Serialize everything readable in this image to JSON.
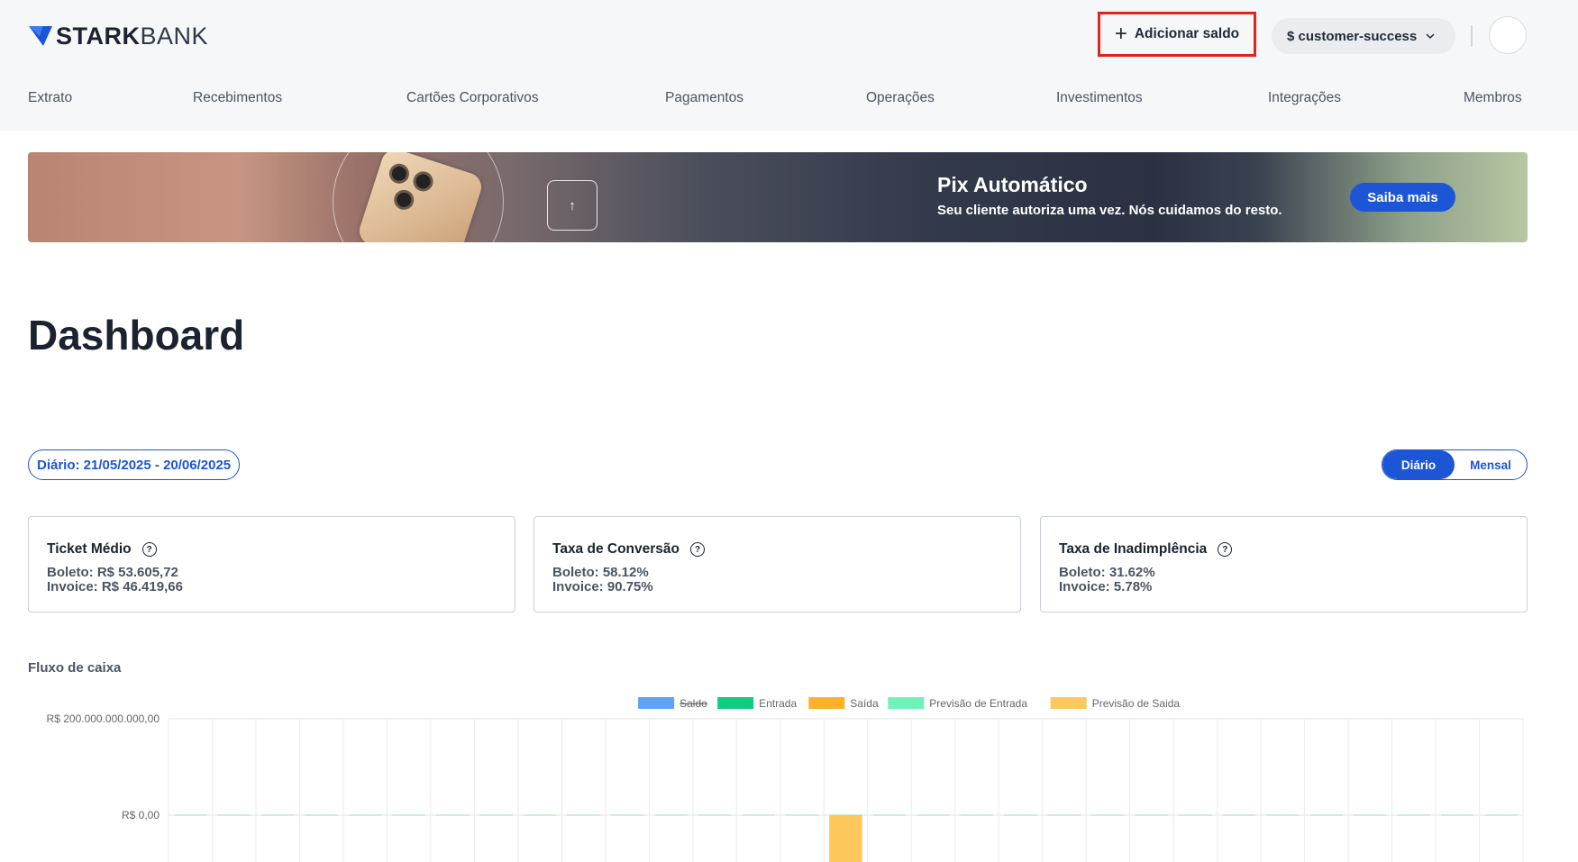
{
  "brand": {
    "name_bold": "STARK",
    "name_light": "BANK"
  },
  "header": {
    "add_balance_label": "Adicionar saldo",
    "workspace_label": "$ customer-success"
  },
  "nav": [
    "Extrato",
    "Recebimentos",
    "Cartões Corporativos",
    "Pagamentos",
    "Operações",
    "Investimentos",
    "Integrações",
    "Membros"
  ],
  "banner": {
    "title": "Pix Automático",
    "subtitle": "Seu cliente autoriza uma vez. Nós cuidamos do resto.",
    "cta": "Saiba mais"
  },
  "page": {
    "title": "Dashboard"
  },
  "filters": {
    "date_range": "Diário: 21/05/2025 - 20/06/2025",
    "view_toggle": [
      "Diário",
      "Mensal"
    ],
    "active_view": "Diário"
  },
  "cards": [
    {
      "title": "Ticket Médio",
      "lines": [
        "Boleto: R$ 53.605,72",
        "Invoice: R$ 46.419,66"
      ]
    },
    {
      "title": "Taxa de Conversão",
      "lines": [
        "Boleto: 58.12%",
        "Invoice: 90.75%"
      ]
    },
    {
      "title": "Taxa de Inadimplência",
      "lines": [
        "Boleto: 31.62%",
        "Invoice: 5.78%"
      ]
    }
  ],
  "cash_flow_label": "Fluxo de caixa",
  "colors": {
    "accent": "#1c55d6",
    "highlight_border": "#e2231a",
    "saldo": "#5fa3f5",
    "entrada": "#0fcf7f",
    "saida": "#fbb12a",
    "previsao_entrada": "#6ff2b8",
    "previsao_saida": "#fcc85c"
  },
  "chart_data": {
    "type": "bar",
    "legend": [
      {
        "name": "Saldo",
        "color": "#5fa3f5",
        "struck": true
      },
      {
        "name": "Entrada",
        "color": "#0fcf7f",
        "struck": false
      },
      {
        "name": "Saída",
        "color": "#fbb12a",
        "struck": false
      },
      {
        "name": "Previsão de Entrada",
        "color": "#6ff2b8",
        "struck": false
      },
      {
        "name": "Previsão de Saida",
        "color": "#fcc85c",
        "struck": false
      }
    ],
    "y_ticks": [
      "R$  200.000.000.000,00",
      "R$  0,00"
    ],
    "y_tick_values": [
      200000000000,
      0
    ],
    "category_count": 31,
    "series": [
      {
        "name": "Previsão de Saida",
        "color": "#fcc85c",
        "values": [
          0,
          0,
          0,
          0,
          0,
          0,
          0,
          0,
          0,
          0,
          0,
          0,
          0,
          0,
          0,
          -120000000000,
          0,
          0,
          0,
          0,
          0,
          0,
          0,
          0,
          0,
          0,
          0,
          0,
          0,
          0,
          0
        ]
      }
    ],
    "legend_placement": "top-center",
    "grid": true
  }
}
